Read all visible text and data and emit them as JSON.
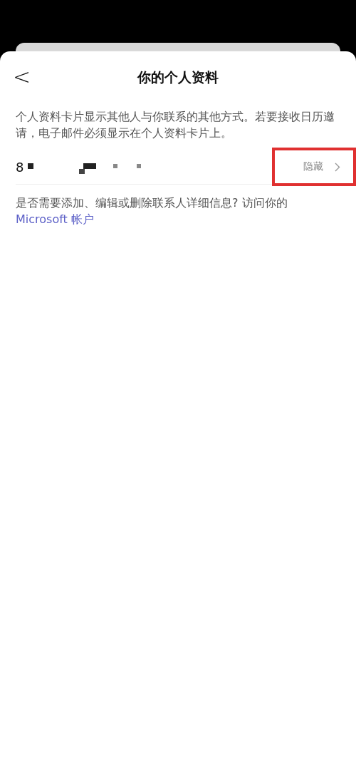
{
  "header": {
    "back": "<",
    "title": "你的个人资料"
  },
  "description": "个人资料卡片显示其他人与你联系的其他方式。若要接收日历邀请，电子邮件必须显示在个人资料卡片上。",
  "contact": {
    "value": "8",
    "visibility": "隐藏",
    "highlighted": true
  },
  "footer": {
    "text": "是否需要添加、编辑或删除联系人详细信息? 访问你的 ",
    "link": "Microsoft 帐户"
  }
}
